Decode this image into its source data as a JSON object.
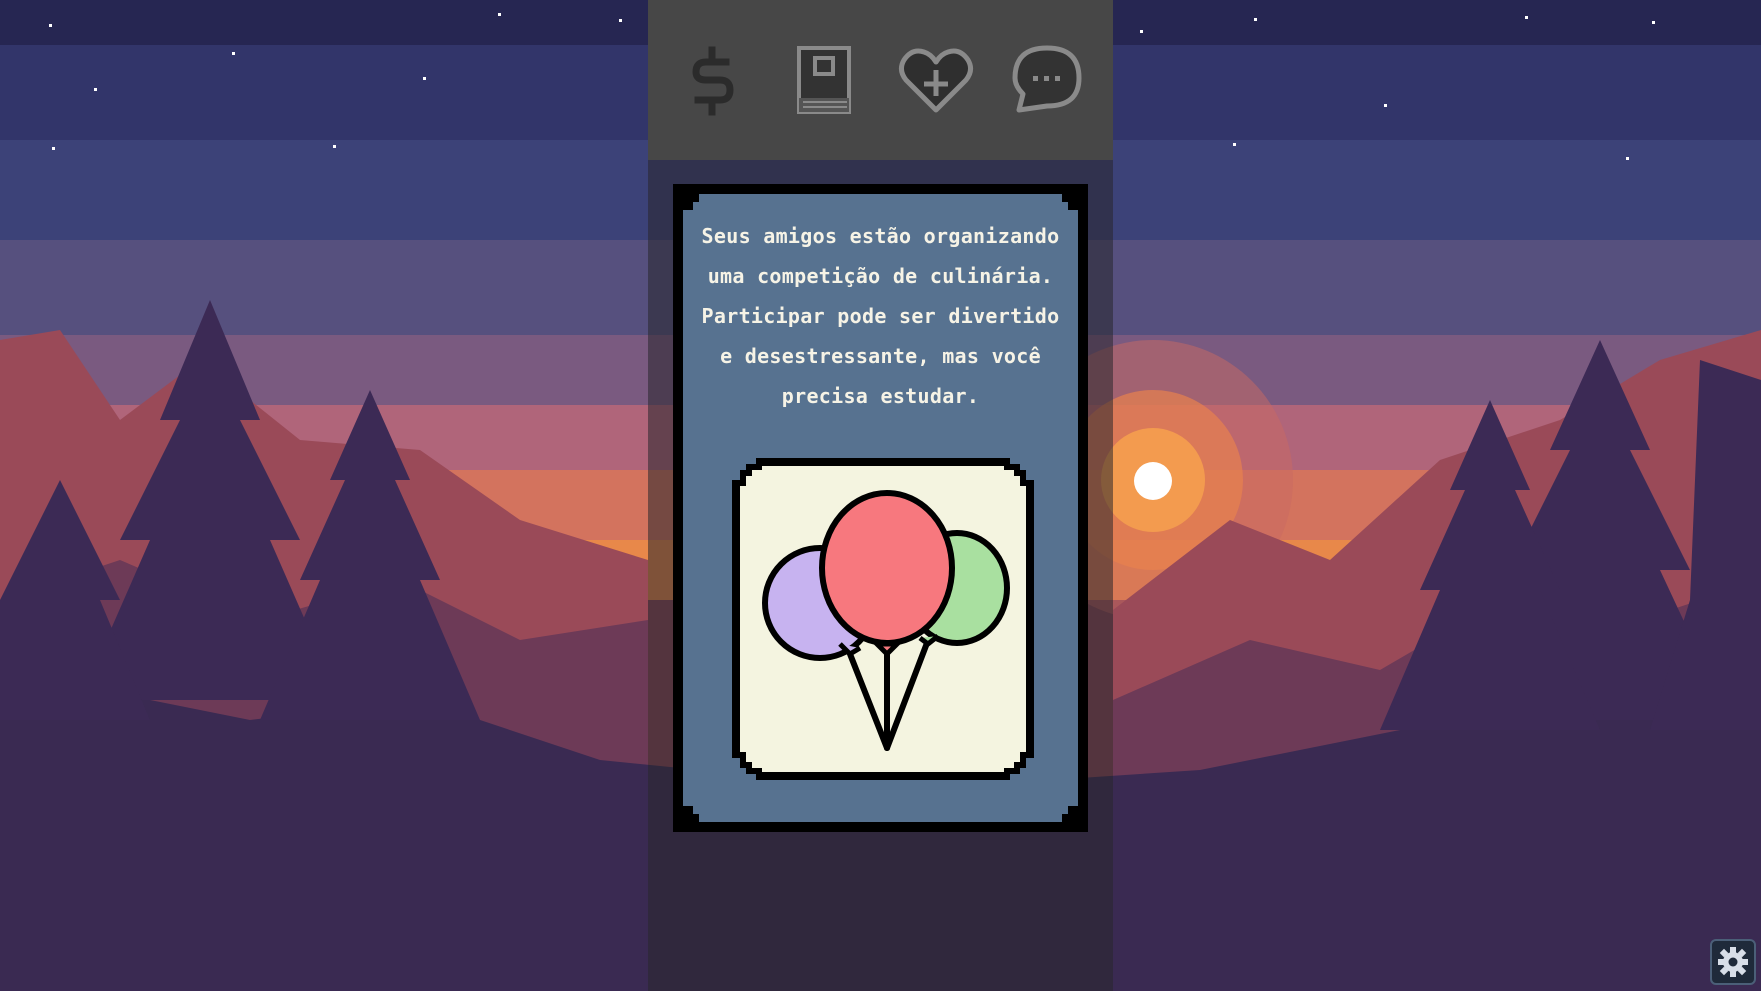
{
  "hud": {
    "stats": [
      {
        "name": "money",
        "icon": "dollar-icon"
      },
      {
        "name": "study",
        "icon": "book-icon"
      },
      {
        "name": "health",
        "icon": "heart-plus-icon"
      },
      {
        "name": "social",
        "icon": "chat-bubble-icon"
      }
    ]
  },
  "card": {
    "text": "Seus amigos estão organizando uma competição de culinária. Participar pode ser divertido e desestressante, mas você precisa estudar.",
    "image_icon": "balloons-icon"
  },
  "settings": {
    "icon": "gear-icon"
  },
  "colors": {
    "card_background": "#577290",
    "card_text": "#f6f3e6",
    "hud_background": "#474747",
    "sky_top": "#262652",
    "sun": "#ffffff"
  }
}
